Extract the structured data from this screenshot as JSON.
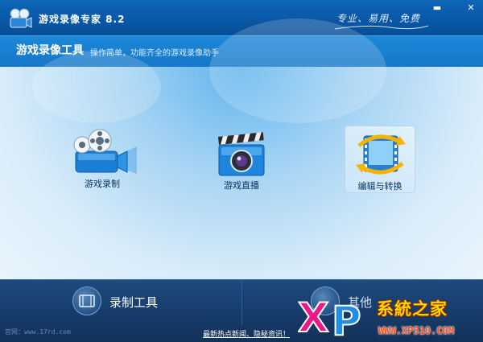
{
  "window": {
    "app_title": "游戏录像专家 8.2",
    "slogan": "专业、易用、免费",
    "minimize_symbol": "▬",
    "close_symbol": "✕"
  },
  "header": {
    "title": "游戏录像工具",
    "subtitle": "操作简单，功能齐全的游戏录像助手"
  },
  "tools": [
    {
      "label": "游戏录制",
      "icon": "video-camera-icon"
    },
    {
      "label": "游戏直播",
      "icon": "clapperboard-camera-icon"
    },
    {
      "label": "编辑与转换",
      "icon": "film-edit-convert-icon"
    }
  ],
  "footer": {
    "record_tools_label": "录制工具",
    "other_label": "其他",
    "website": "官网：www.17rd.com",
    "news_link": "最新热点新闻、隐秘资讯！"
  },
  "watermark": {
    "logo_text": "XP",
    "name": "系統之家",
    "url": "WWW.XP510.COM"
  },
  "colors": {
    "titlebar": "#0a5aa9",
    "header": "#1677c9",
    "footer": "#163a68",
    "accent": "#ffd400",
    "watermark_pink": "#e8198b"
  }
}
